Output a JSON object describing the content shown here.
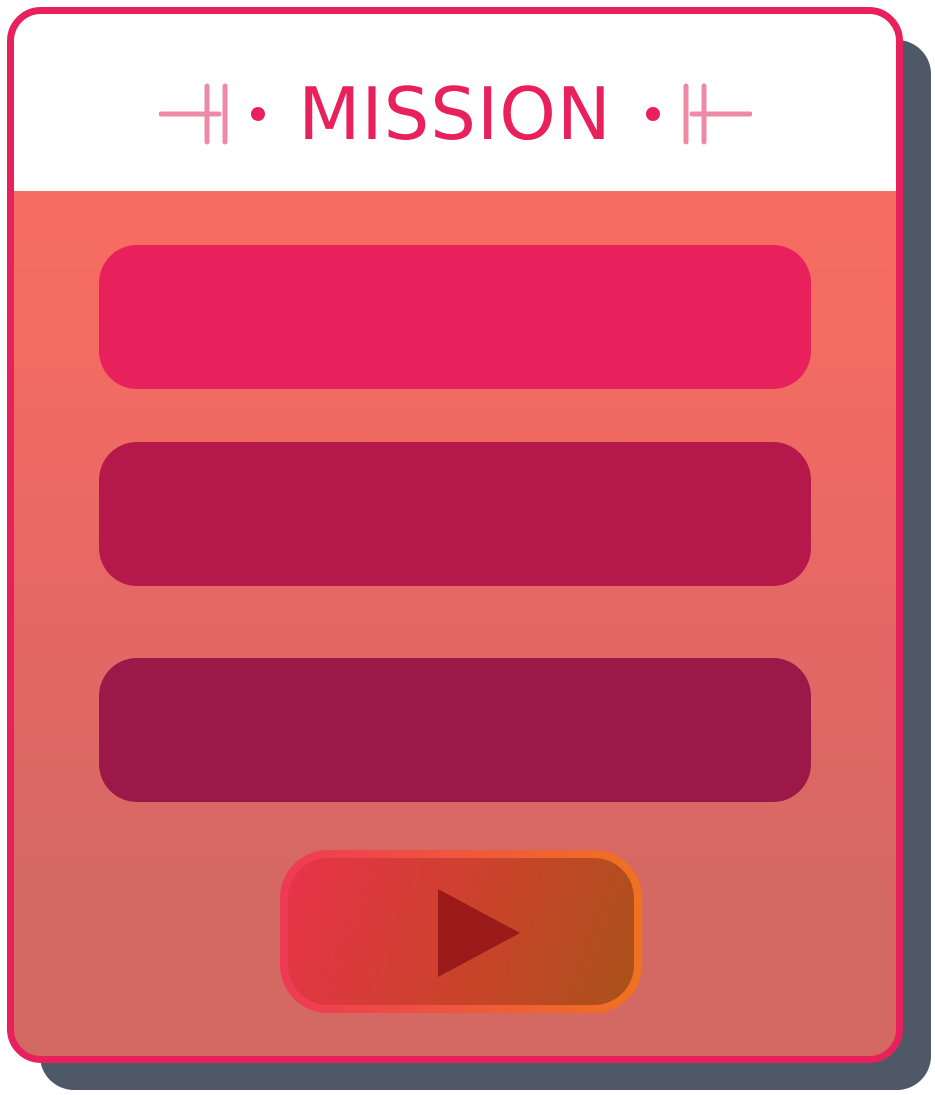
{
  "header": {
    "title": "MISSION",
    "ornament_left_icon": "ornament-divider-left-icon",
    "ornament_right_icon": "ornament-divider-right-icon"
  },
  "missions": [
    {
      "color": "#e8215c"
    },
    {
      "color": "#b5194b"
    },
    {
      "color": "#9c1848"
    }
  ],
  "play": {
    "icon": "play-icon",
    "icon_color": "#9a1a1a"
  },
  "colors": {
    "accent": "#e8215c",
    "ornament": "#ef8aa6",
    "shadow": "#4f5866"
  }
}
